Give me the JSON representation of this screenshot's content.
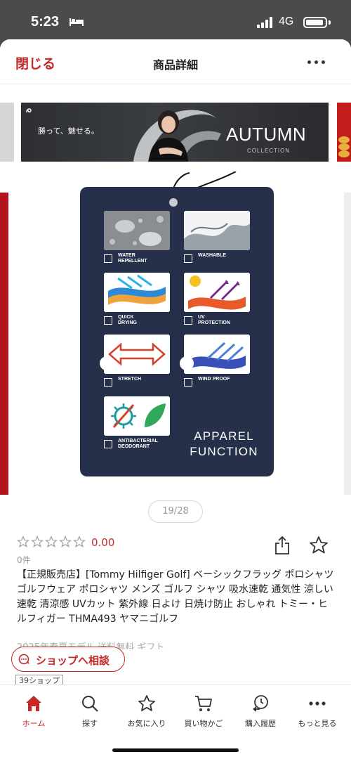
{
  "status_bar": {
    "time": "5:23",
    "network": "4G",
    "bed_icon": "bed-icon",
    "signal_icon": "signal-icon",
    "battery_icon": "battery-icon"
  },
  "header": {
    "close_label": "閉じる",
    "title": "商品詳細",
    "more_icon": "ellipsis-icon"
  },
  "banner": {
    "tagline": "勝って、魅せる。",
    "headline": "AUTUMN",
    "subline": "COLLECTION"
  },
  "product_image": {
    "tag_features": [
      {
        "label": "WATER\nREPELLENT",
        "icon": "water-drops-icon"
      },
      {
        "label": "WASHABLE",
        "icon": "water-splash-icon"
      },
      {
        "label": "QUICK\nDRYING",
        "icon": "quick-drying-icon"
      },
      {
        "label": "UV\nPROTECTION",
        "icon": "uv-sun-icon"
      },
      {
        "label": "STRETCH",
        "icon": "stretch-arrows-icon"
      },
      {
        "label": "WIND PROOF",
        "icon": "wind-proof-icon"
      },
      {
        "label": "ANTIBACTERIAL\nDEODORANT",
        "icon": "antibacterial-icon"
      }
    ],
    "tag_title": "APPAREL\nFUNCTION",
    "page_indicator": "19/28"
  },
  "rating": {
    "value": "0.00",
    "stars_filled": 0,
    "stars_total": 5,
    "review_count": "0件"
  },
  "product": {
    "title": "【正規販売店】[Tommy Hilfiger Golf] ベーシックフラッグ ポロシャツ ゴルフウェア ポロシャツ メンズ ゴルフ シャツ 吸水速乾 通気性 涼しい 速乾 清涼感 UVカット 紫外線 日よけ 日焼け防止 おしゃれ トミー・ヒルフィガー THMA493 ヤマニゴルフ",
    "subinfo": "2025年春夏モデル 送料無料 ギフト",
    "consult_label": "ショップへ相談",
    "shop_count": "39ショップ"
  },
  "accent_color": "#c62828",
  "bottom_nav": [
    {
      "label": "ホーム",
      "icon": "home-icon",
      "active": true
    },
    {
      "label": "探す",
      "icon": "search-icon",
      "active": false
    },
    {
      "label": "お気に入り",
      "icon": "star-icon",
      "active": false
    },
    {
      "label": "買い物かご",
      "icon": "cart-icon",
      "active": false
    },
    {
      "label": "購入履歴",
      "icon": "history-icon",
      "active": false
    },
    {
      "label": "もっと見る",
      "icon": "ellipsis-icon",
      "active": false
    }
  ]
}
